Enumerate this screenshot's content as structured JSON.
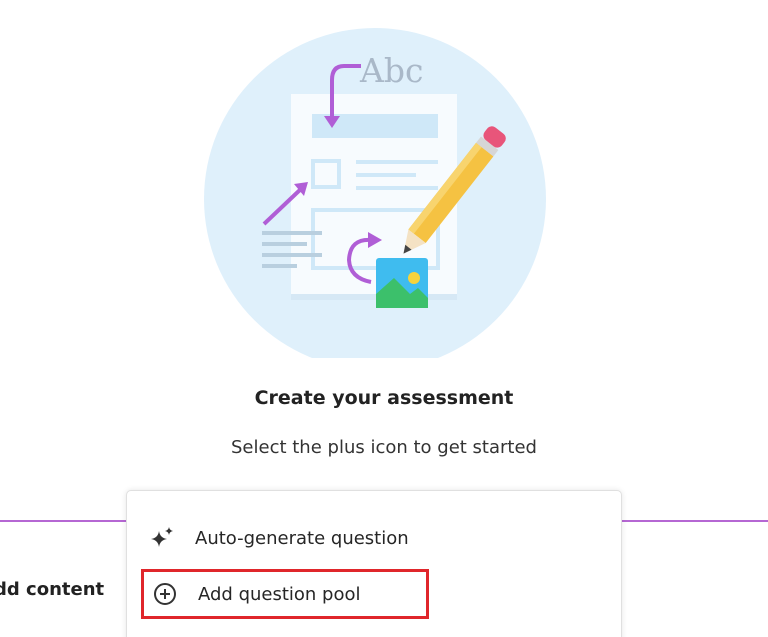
{
  "illustration": {
    "text": "Abc",
    "colors": {
      "circle": "#dff0fb",
      "paper": "#f7fbfe",
      "highlight_bar": "#cfe8f8",
      "arrow": "#b05ed6",
      "pencil_body": "#f5c242",
      "pencil_eraser": "#e8557a",
      "image_sky": "#3fbcef",
      "image_hill": "#3cc06b",
      "image_sun": "#f6d33c"
    }
  },
  "empty_state": {
    "title": "Create your assessment",
    "subtitle": "Select the plus icon to get started"
  },
  "add_content_label": "dd content",
  "menu": {
    "items": [
      {
        "icon": "sparkle-icon",
        "label": "Auto-generate question"
      },
      {
        "icon": "plus-circle-icon",
        "label": "Add question pool",
        "highlighted": true
      }
    ]
  },
  "colors": {
    "divider": "#b567d3",
    "highlight_border": "#e0262b"
  }
}
